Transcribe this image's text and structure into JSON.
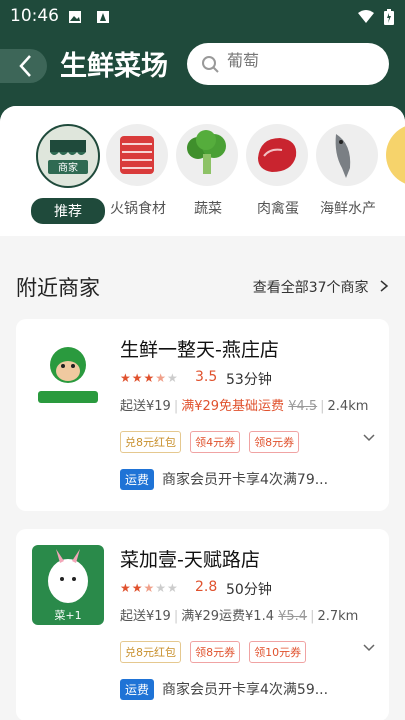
{
  "status": {
    "time": "10:46"
  },
  "header": {
    "title": "生鲜菜场",
    "search_placeholder": "葡萄"
  },
  "categories": [
    {
      "label": "推荐",
      "icon": "market-stall-icon",
      "active": true
    },
    {
      "label": "火锅食材",
      "icon": "hotpot-meat-icon"
    },
    {
      "label": "蔬菜",
      "icon": "broccoli-icon"
    },
    {
      "label": "肉禽蛋",
      "icon": "steak-icon"
    },
    {
      "label": "海鲜水产",
      "icon": "fish-icon"
    }
  ],
  "section": {
    "title": "附近商家",
    "view_all": "查看全部37个商家"
  },
  "stores": [
    {
      "name": "生鲜一整天-燕庄店",
      "rating": "3.5",
      "eta": "53分钟",
      "min_order": "起送¥19",
      "delivery": "满¥29免基础运费",
      "orig_fee": "¥4.5",
      "distance": "2.4km",
      "tags": [
        "兑8元红包",
        "领4元券",
        "领8元券"
      ],
      "promo_badge": "运费",
      "promo_text": "商家会员开卡享4次满79..."
    },
    {
      "name": "菜加壹-天赋路店",
      "rating": "2.8",
      "eta": "50分钟",
      "min_order": "起送¥19",
      "delivery": "满¥29运费¥1.4",
      "orig_fee": "¥5.4",
      "distance": "2.7km",
      "tags": [
        "兑8元红包",
        "领8元券",
        "领10元券"
      ],
      "promo_badge": "运费",
      "promo_text": "商家会员开卡享4次满59..."
    }
  ]
}
